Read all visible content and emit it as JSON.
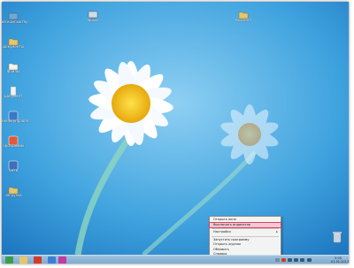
{
  "desktop_icons_left": [
    {
      "label": "Мой компьютер",
      "icon": "computer-icon",
      "color": "#6ea8d8"
    },
    {
      "label": "Документы",
      "icon": "folder-icon",
      "color": "#e8c567"
    },
    {
      "label": "Файлы",
      "icon": "folder-icon",
      "color": "#f2f2f2"
    },
    {
      "label": "Документ",
      "icon": "document-icon",
      "color": "#f2f2f2"
    },
    {
      "label": "Панель управления",
      "icon": "control-panel-icon",
      "color": "#3b79c4"
    },
    {
      "label": "Программы",
      "icon": "programs-icon",
      "color": "#e05a3a"
    },
    {
      "label": "Сеть",
      "icon": "network-icon",
      "color": "#3f6fb8"
    },
    {
      "label": "Загрузки",
      "icon": "folder-icon",
      "color": "#e8c567"
    }
  ],
  "desktop_icons_top": [
    {
      "label": "Ярлык",
      "icon": "shortcut-icon",
      "color": "#d2dbe4"
    },
    {
      "label": "Корзина",
      "icon": "folder-icon",
      "color": "#e8c567"
    }
  ],
  "taskbar": {
    "buttons": [
      {
        "name": "start",
        "color": "#3a9d4c"
      },
      {
        "name": "explorer",
        "color": "#e8c567"
      },
      {
        "name": "opera",
        "color": "#d33a2c"
      },
      {
        "name": "browser",
        "color": "#3d7fd6"
      },
      {
        "name": "media",
        "color": "#c03aa2"
      }
    ],
    "clock_time": "0:00",
    "clock_date": "01.01.2013"
  },
  "context_menu": {
    "items": [
      {
        "label": "Открыть окно",
        "highlight": false,
        "submenu": false
      },
      {
        "label": "Выключить индикатор",
        "highlight": true,
        "submenu": false
      },
      {
        "sep": true
      },
      {
        "label": "Настройки",
        "highlight": false,
        "submenu": true
      },
      {
        "sep": true
      },
      {
        "label": "Запустить программу",
        "highlight": false,
        "submenu": false
      },
      {
        "label": "Открыть журнал",
        "highlight": false,
        "submenu": false
      },
      {
        "label": "Обновить",
        "highlight": false,
        "submenu": false
      },
      {
        "label": "Справка",
        "highlight": false,
        "submenu": false
      }
    ]
  },
  "recycle_bin": {
    "icon": "recycle-bin-icon"
  }
}
